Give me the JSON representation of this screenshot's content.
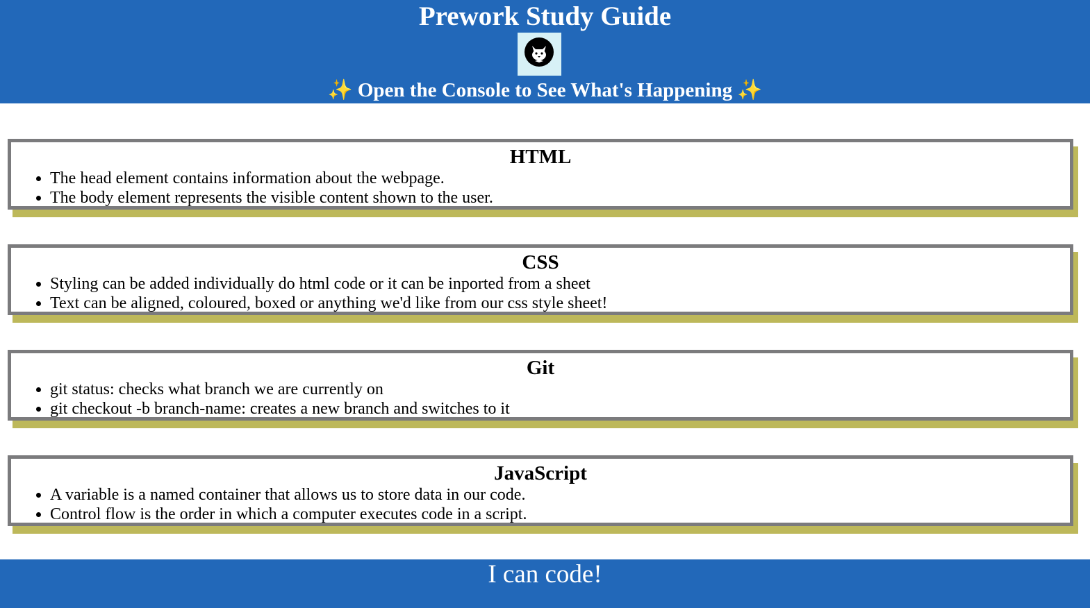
{
  "colors": {
    "accent": "#2268b9",
    "card_border": "#7b7b7d",
    "card_shadow": "#bdb85a",
    "logo_bg": "#d7f1f6"
  },
  "header": {
    "title": "Prework Study Guide",
    "logo_icon": "cat-face-icon",
    "subtitle_spark": "✨",
    "subtitle": "Open the Console to See What's Happening"
  },
  "sections": [
    {
      "heading": "HTML",
      "items": [
        "The head element contains information about the webpage.",
        "The body element represents the visible content shown to the user."
      ]
    },
    {
      "heading": "CSS",
      "items": [
        "Styling can be added individually do html code or it can be inported from a sheet",
        "Text can be aligned, coloured, boxed or anything we'd like from our css style sheet!"
      ]
    },
    {
      "heading": "Git",
      "items": [
        "git status: checks what branch we are currently on",
        "git checkout -b branch-name: creates a new branch and switches to it"
      ]
    },
    {
      "heading": "JavaScript",
      "items": [
        "A variable is a named container that allows us to store data in our code.",
        "Control flow is the order in which a computer executes code in a script."
      ]
    }
  ],
  "footer": {
    "text": "I can code!"
  }
}
